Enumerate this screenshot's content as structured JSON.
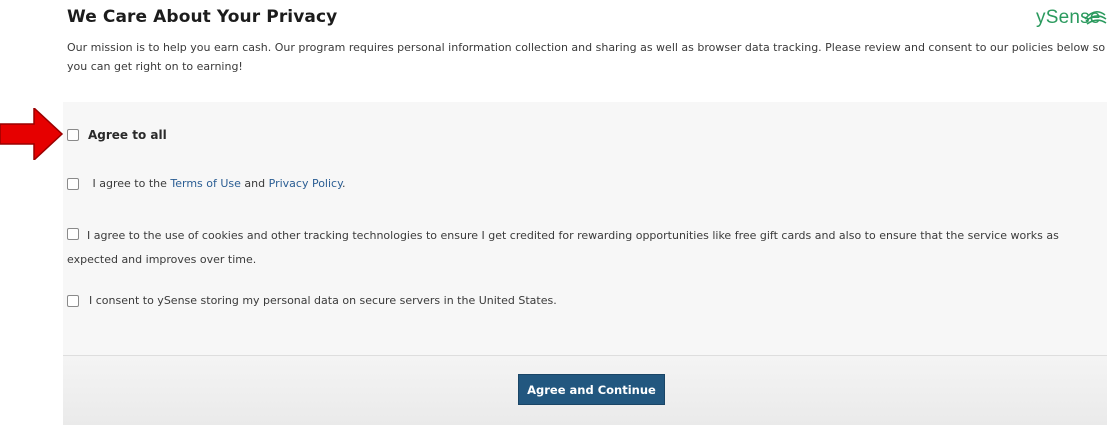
{
  "header": {
    "title": "We Care About Your Privacy",
    "logo_text": "ySense",
    "intro": "Our mission is to help you earn cash. Our program requires personal information collection and sharing as well as browser data tracking. Please review and consent to our policies below so you can get right on to earning!"
  },
  "consents": {
    "agree_all": "Agree to all",
    "terms_prefix": " I agree to the ",
    "terms_link": "Terms of Use",
    "terms_and": " and ",
    "privacy_link": "Privacy Policy",
    "terms_suffix": ".",
    "cookies": "I agree to the use of cookies and other tracking technologies to ensure I get credited for rewarding opportunities like free gift cards and also to ensure that the service works as expected and improves over time.",
    "data_storage": "I consent to ySense storing my personal data on secure servers in the United States."
  },
  "footer": {
    "submit_label": "Agree and Continue"
  },
  "colors": {
    "button": "#22577f",
    "link": "#2a5d93",
    "logo": "#2b9a5e",
    "arrow": "#e60000"
  }
}
